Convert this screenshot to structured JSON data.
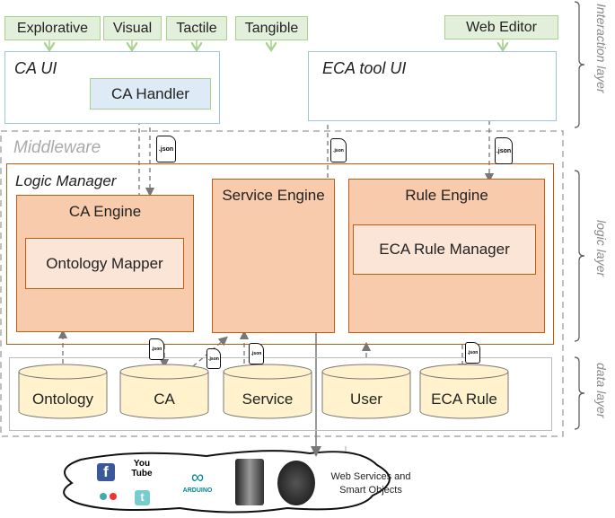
{
  "interaction_inputs": [
    "Explorative",
    "Visual",
    "Tactile",
    "Tangible"
  ],
  "web_editor": "Web Editor",
  "ca_ui": "CA UI",
  "ca_handler": "CA Handler",
  "eca_tool_ui": "ECA tool UI",
  "middleware": "Middleware",
  "logic_manager": "Logic Manager",
  "ca_engine": "CA Engine",
  "ontology_mapper": "Ontology Mapper",
  "service_engine": "Service Engine",
  "rule_engine": "Rule Engine",
  "eca_rule_manager": "ECA Rule Manager",
  "databases": [
    "Ontology",
    "CA",
    "Service",
    "User",
    "ECA Rule"
  ],
  "json_label": ".json",
  "layers": {
    "interaction": "Interaction layer",
    "logic": "logic layer",
    "data": "data layer"
  },
  "cloud": {
    "line1": "Web Services and",
    "line2": "Smart Objects",
    "icons": [
      "facebook-icon",
      "youtube-icon",
      "flickr-icon",
      "twitter-icon",
      "arduino-icon",
      "coffee-maker-icon",
      "smartwatch-icon"
    ],
    "youtube_text": "You Tube",
    "arduino_text": "ARDUINO"
  },
  "colors": {
    "green": "#e2efda",
    "blue": "#9dc3e6",
    "orange": "#c55a11",
    "engine": "#f8cbad",
    "db": "#fff2cc"
  }
}
